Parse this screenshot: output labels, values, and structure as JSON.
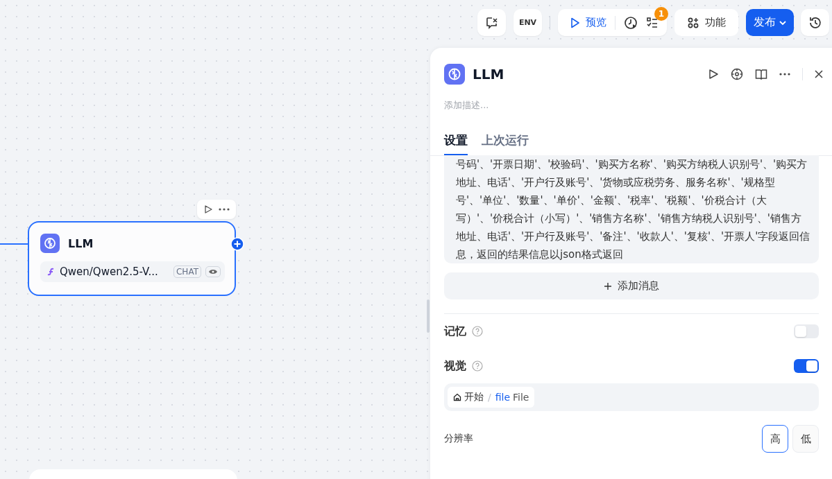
{
  "toolbar": {
    "env_label": "ENV",
    "preview_label": "预览",
    "checklist_badge": "1",
    "features_label": "功能",
    "publish_label": "发布"
  },
  "node": {
    "title": "LLM",
    "model": "Qwen/Qwen2.5-V...",
    "model_tag": "CHAT",
    "selected": true
  },
  "panel": {
    "title": "LLM",
    "description_placeholder": "添加描述...",
    "tabs": [
      {
        "label": "设置",
        "selected": true
      },
      {
        "label": "上次运行",
        "selected": false
      }
    ],
    "prompt_text": "号码'、'开票日期'、'校验码'、'购买方名称'、'购买方纳税人识别号'、'购买方地址、电话'、'开户行及账号'、'货物或应税劳务、服务名称'、'规格型号'、'单位'、'数量'、'单价'、'金额'、'税率'、'税额'、'价税合计（大写）'、'价税合计（小写）'、'销售方名称'、'销售方纳税人识别号'、'销售方地址、电话'、'开户行及账号'、'备注'、'收款人'、'复核'、'开票人'字段返回信息，返回的结果信息以json格式返回",
    "add_message_label": "添加消息",
    "settings": [
      {
        "label": "记忆",
        "on": false
      },
      {
        "label": "视觉",
        "on": true
      }
    ],
    "variable": {
      "node": "开始",
      "separator": "/",
      "var_type": "file",
      "var_name": "File"
    },
    "resolution": {
      "label": "分辨率",
      "options": [
        {
          "label": "高",
          "selected": true
        },
        {
          "label": "低",
          "selected": false
        }
      ]
    }
  }
}
